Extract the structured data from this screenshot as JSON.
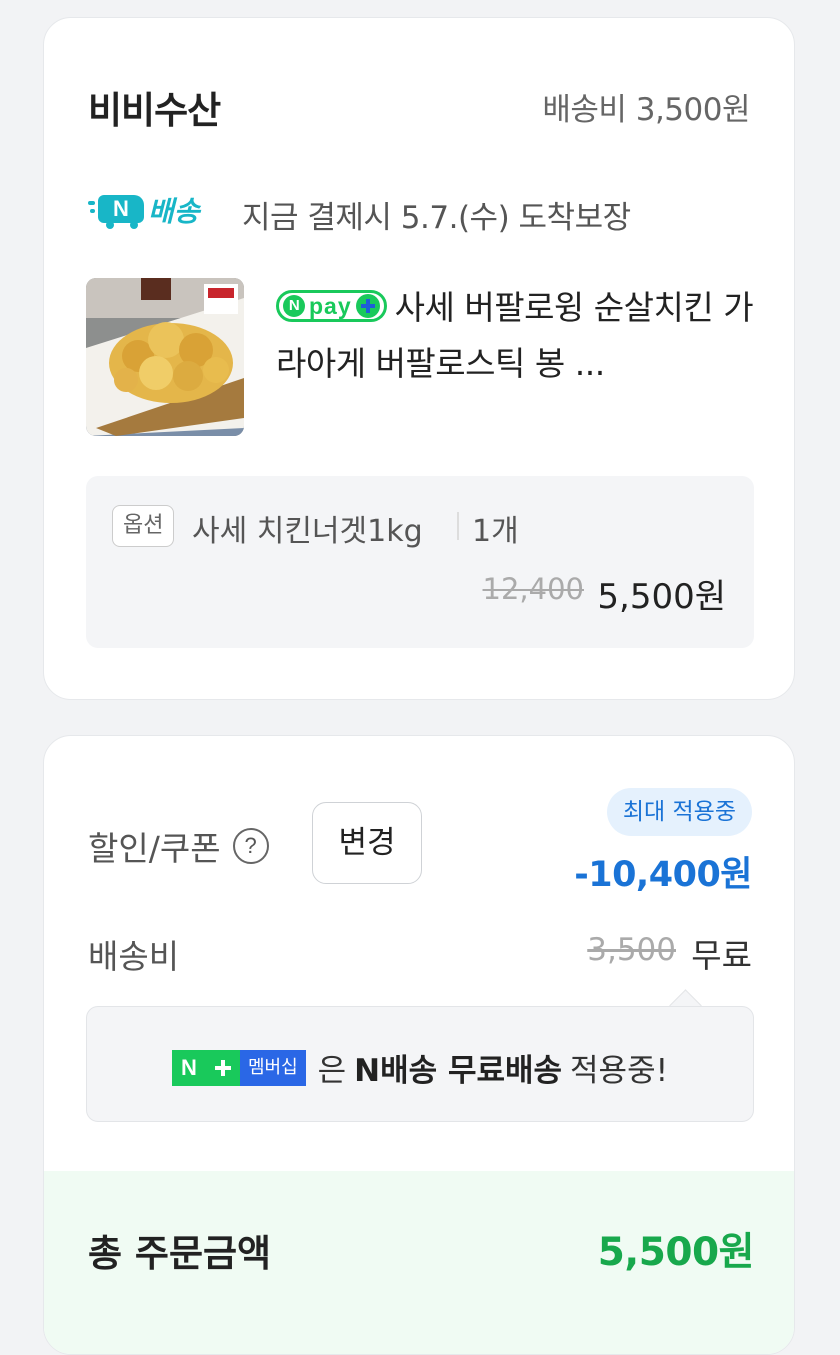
{
  "seller": {
    "name": "비비수산",
    "shipping_fee": "배송비 3,500원"
  },
  "delivery": {
    "badge_label": "배송",
    "arrival_text": "지금 결제시 5.7.(수) 도착보장"
  },
  "product": {
    "npay_badge": "pay",
    "title": "사세 버팔로윙 순살치킨 가라아게 버팔로스틱 봉 ...",
    "option_tag": "옵션",
    "option_name": "사세 치킨너겟1kg",
    "quantity": "1개",
    "original_price": "12,400",
    "price": "5,500원"
  },
  "discount": {
    "label": "할인/쿠폰",
    "help_icon": "?",
    "change_button": "변경",
    "max_badge": "최대 적용중",
    "amount": "-10,400원"
  },
  "shipping": {
    "label": "배송비",
    "original": "3,500",
    "value": "무료"
  },
  "membership": {
    "badge_text": "멤버십",
    "prefix": "은",
    "bold_text": "N배송 무료배송",
    "suffix": "적용중!"
  },
  "total": {
    "label": "총 주문금액",
    "amount": "5,500원"
  },
  "colors": {
    "accent_green": "#19c95b",
    "accent_blue": "#1a73d6",
    "delivery_teal": "#18b6c7"
  }
}
